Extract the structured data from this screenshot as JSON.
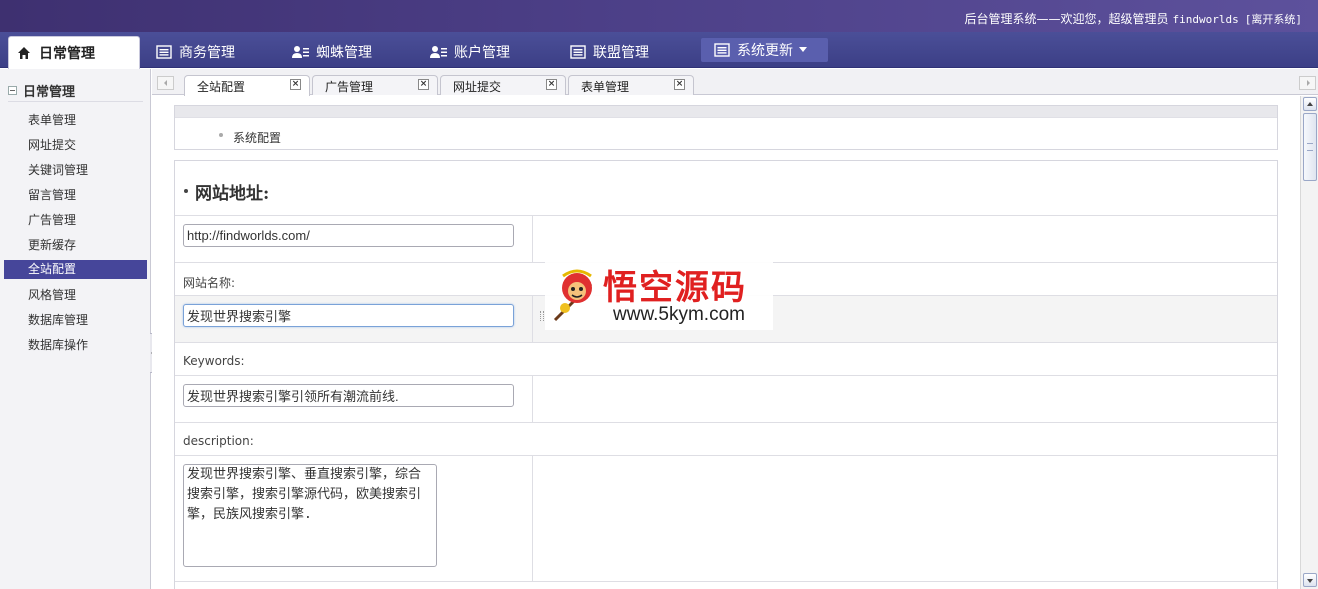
{
  "header": {
    "welcome": "后台管理系统——欢迎您，超级管理员",
    "username": "findworlds",
    "logout": "[离开系统]"
  },
  "nav": {
    "tabs": [
      {
        "label": "日常管理",
        "icon": "home-icon"
      },
      {
        "label": "商务管理",
        "icon": "list-icon"
      },
      {
        "label": "蜘蛛管理",
        "icon": "users-icon"
      },
      {
        "label": "账户管理",
        "icon": "users-icon"
      },
      {
        "label": "联盟管理",
        "icon": "list-icon"
      },
      {
        "label": "系统更新",
        "icon": "list-icon"
      }
    ]
  },
  "sidebar": {
    "title": "日常管理",
    "items": [
      {
        "label": "表单管理"
      },
      {
        "label": "网址提交"
      },
      {
        "label": "关键词管理"
      },
      {
        "label": "留言管理"
      },
      {
        "label": "广告管理"
      },
      {
        "label": "更新缓存"
      },
      {
        "label": "全站配置",
        "active": true
      },
      {
        "label": "风格管理"
      },
      {
        "label": "数据库管理"
      },
      {
        "label": "数据库操作"
      }
    ]
  },
  "tabs": [
    {
      "label": "全站配置",
      "active": true
    },
    {
      "label": "广告管理"
    },
    {
      "label": "网址提交"
    },
    {
      "label": "表单管理"
    }
  ],
  "breadcrumb": "系统配置",
  "form": {
    "section_title": "网站地址:",
    "site_url": "http://findworlds.com/",
    "site_name_label": "网站名称:",
    "site_name": "发现世界搜索引擎",
    "keywords_label": "Keywords:",
    "keywords": "发现世界搜索引擎引领所有潮流前线.",
    "description_label": "description:",
    "description": "发现世界搜索引擎、垂直搜索引擎，综合搜索引擎，搜索引擎源代码，欧美搜索引擎，民族风搜索引擎."
  },
  "watermark": {
    "title": "悟空源码",
    "url": "www.5kym.com"
  }
}
